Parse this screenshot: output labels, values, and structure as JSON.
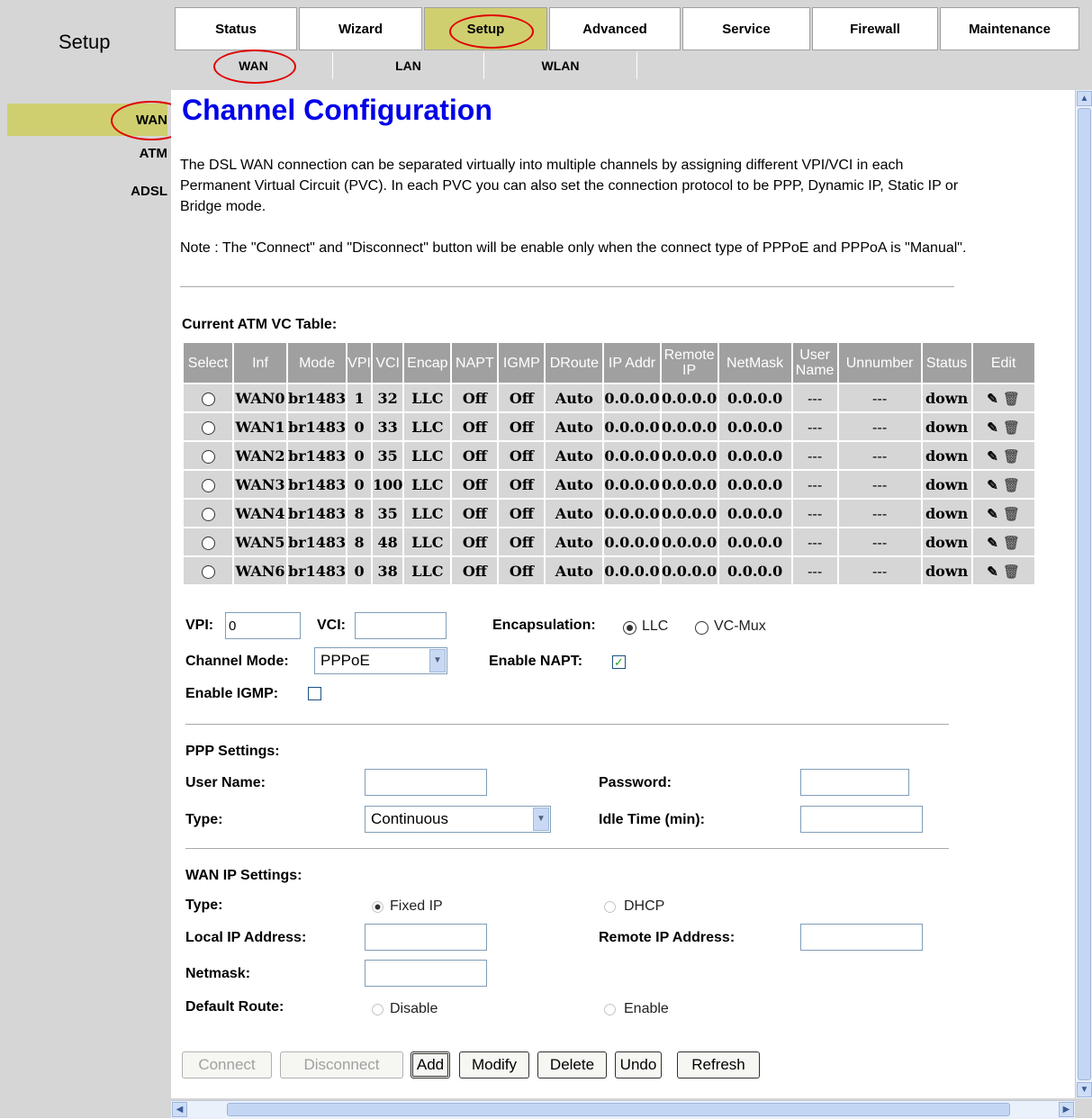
{
  "app": {
    "section_title": "Setup"
  },
  "top_tabs": [
    {
      "label": "Status",
      "active": false
    },
    {
      "label": "Wizard",
      "active": false
    },
    {
      "label": "Setup",
      "active": true
    },
    {
      "label": "Advanced",
      "active": false
    },
    {
      "label": "Service",
      "active": false
    },
    {
      "label": "Firewall",
      "active": false
    },
    {
      "label": "Maintenance",
      "active": false
    }
  ],
  "sub_tabs": [
    {
      "label": "WAN",
      "active": true
    },
    {
      "label": "LAN",
      "active": false
    },
    {
      "label": "WLAN",
      "active": false
    }
  ],
  "sidebar": {
    "items": [
      {
        "label": "WAN",
        "active": true
      },
      {
        "label": "ATM"
      },
      {
        "label": "ADSL"
      }
    ]
  },
  "main": {
    "title": "Channel Configuration",
    "description": "The DSL WAN connection can be separated virtually into multiple channels by assigning different VPI/VCI in each Permanent Virtual Circuit (PVC). In each PVC you can also set the connection protocol to be PPP, Dynamic IP, Static IP or Bridge mode.",
    "note": "Note : The \"Connect\" and \"Disconnect\" button will be enable only when the connect type of PPPoE and PPPoA is \"Manual\".",
    "table_title": "Current ATM VC Table:"
  },
  "table": {
    "headers": [
      "Select",
      "Inf",
      "Mode",
      "VPI",
      "VCI",
      "Encap",
      "NAPT",
      "IGMP",
      "DRoute",
      "IP Addr",
      "Remote IP",
      "NetMask",
      "User Name",
      "Unnumber",
      "Status",
      "Edit"
    ],
    "rows": [
      [
        "WAN0",
        "br1483",
        "1",
        "32",
        "LLC",
        "Off",
        "Off",
        "Auto",
        "0.0.0.0",
        "0.0.0.0",
        "0.0.0.0",
        "---",
        "---",
        "down"
      ],
      [
        "WAN1",
        "br1483",
        "0",
        "33",
        "LLC",
        "Off",
        "Off",
        "Auto",
        "0.0.0.0",
        "0.0.0.0",
        "0.0.0.0",
        "---",
        "---",
        "down"
      ],
      [
        "WAN2",
        "br1483",
        "0",
        "35",
        "LLC",
        "Off",
        "Off",
        "Auto",
        "0.0.0.0",
        "0.0.0.0",
        "0.0.0.0",
        "---",
        "---",
        "down"
      ],
      [
        "WAN3",
        "br1483",
        "0",
        "100",
        "LLC",
        "Off",
        "Off",
        "Auto",
        "0.0.0.0",
        "0.0.0.0",
        "0.0.0.0",
        "---",
        "---",
        "down"
      ],
      [
        "WAN4",
        "br1483",
        "8",
        "35",
        "LLC",
        "Off",
        "Off",
        "Auto",
        "0.0.0.0",
        "0.0.0.0",
        "0.0.0.0",
        "---",
        "---",
        "down"
      ],
      [
        "WAN5",
        "br1483",
        "8",
        "48",
        "LLC",
        "Off",
        "Off",
        "Auto",
        "0.0.0.0",
        "0.0.0.0",
        "0.0.0.0",
        "---",
        "---",
        "down"
      ],
      [
        "WAN6",
        "br1483",
        "0",
        "38",
        "LLC",
        "Off",
        "Off",
        "Auto",
        "0.0.0.0",
        "0.0.0.0",
        "0.0.0.0",
        "---",
        "---",
        "down"
      ]
    ]
  },
  "form": {
    "vpi_label": "VPI:",
    "vpi_value": "0",
    "vci_label": "VCI:",
    "vci_value": "",
    "encap_label": "Encapsulation:",
    "encap_llc": "LLC",
    "encap_vcmux": "VC-Mux",
    "channel_mode_label": "Channel Mode:",
    "channel_mode_value": "PPPoE",
    "napt_label": "Enable NAPT:",
    "napt_checked": true,
    "igmp_label": "Enable IGMP:",
    "igmp_checked": false
  },
  "ppp": {
    "title": "PPP Settings:",
    "username_label": "User Name:",
    "username_value": "",
    "password_label": "Password:",
    "password_value": "",
    "type_label": "Type:",
    "type_value": "Continuous",
    "idle_label": "Idle Time (min):",
    "idle_value": ""
  },
  "wanip": {
    "title": "WAN IP Settings:",
    "type_label": "Type:",
    "fixed_ip": "Fixed IP",
    "dhcp": "DHCP",
    "local_ip_label": "Local IP Address:",
    "remote_ip_label": "Remote IP Address:",
    "netmask_label": "Netmask:",
    "default_route_label": "Default Route:",
    "disable": "Disable",
    "enable": "Enable"
  },
  "buttons": {
    "connect": "Connect",
    "disconnect": "Disconnect",
    "add": "Add",
    "modify": "Modify",
    "delete": "Delete",
    "undo": "Undo",
    "refresh": "Refresh"
  },
  "colors": {
    "title": "#0000e8",
    "active_tab": "#cfcf70",
    "table_header": "#a0a0a0",
    "table_cell": "#d6d6d6",
    "annotation": "#e00000"
  },
  "icons": {
    "edit": "pencil-icon",
    "delete": "trash-icon"
  }
}
